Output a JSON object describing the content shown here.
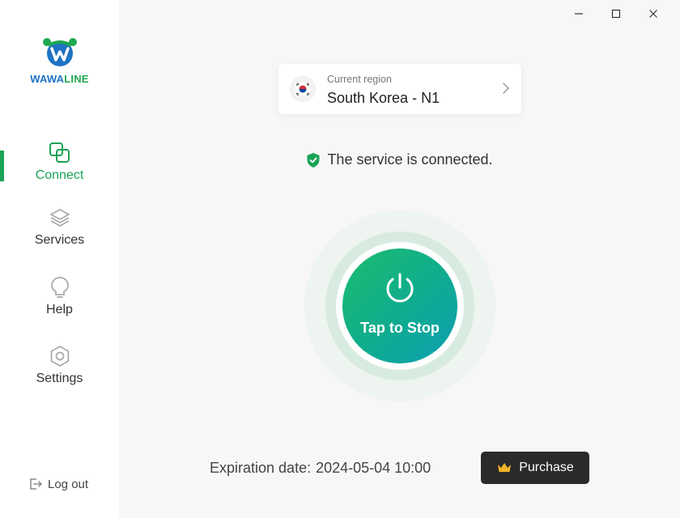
{
  "app": {
    "logo_text_blue": "WAWA",
    "logo_text_green": "LINE"
  },
  "sidebar": {
    "items": [
      {
        "label": "Connect",
        "icon": "connect-icon",
        "active": true
      },
      {
        "label": "Services",
        "icon": "layers-icon",
        "active": false
      },
      {
        "label": "Help",
        "icon": "lightbulb-icon",
        "active": false
      },
      {
        "label": "Settings",
        "icon": "hexagon-gear-icon",
        "active": false
      }
    ],
    "logout_label": "Log out"
  },
  "window": {
    "minimize": "minimize-icon",
    "maximize": "maximize-icon",
    "close": "close-icon"
  },
  "region": {
    "caption": "Current region",
    "name": "South Korea - N1",
    "flag": "south-korea-flag-icon"
  },
  "status": {
    "text": "The service is connected."
  },
  "power": {
    "label": "Tap to Stop"
  },
  "footer": {
    "expiry_label": "Expiration date:",
    "expiry_value": "2024-05-04 10:00",
    "purchase_label": "Purchase"
  },
  "colors": {
    "accent": "#1aa356",
    "logo_blue": "#1f73c4",
    "button_dark": "#2a2a2a",
    "gradient_start": "#1bbd6e",
    "gradient_end": "#0c9fb4"
  }
}
